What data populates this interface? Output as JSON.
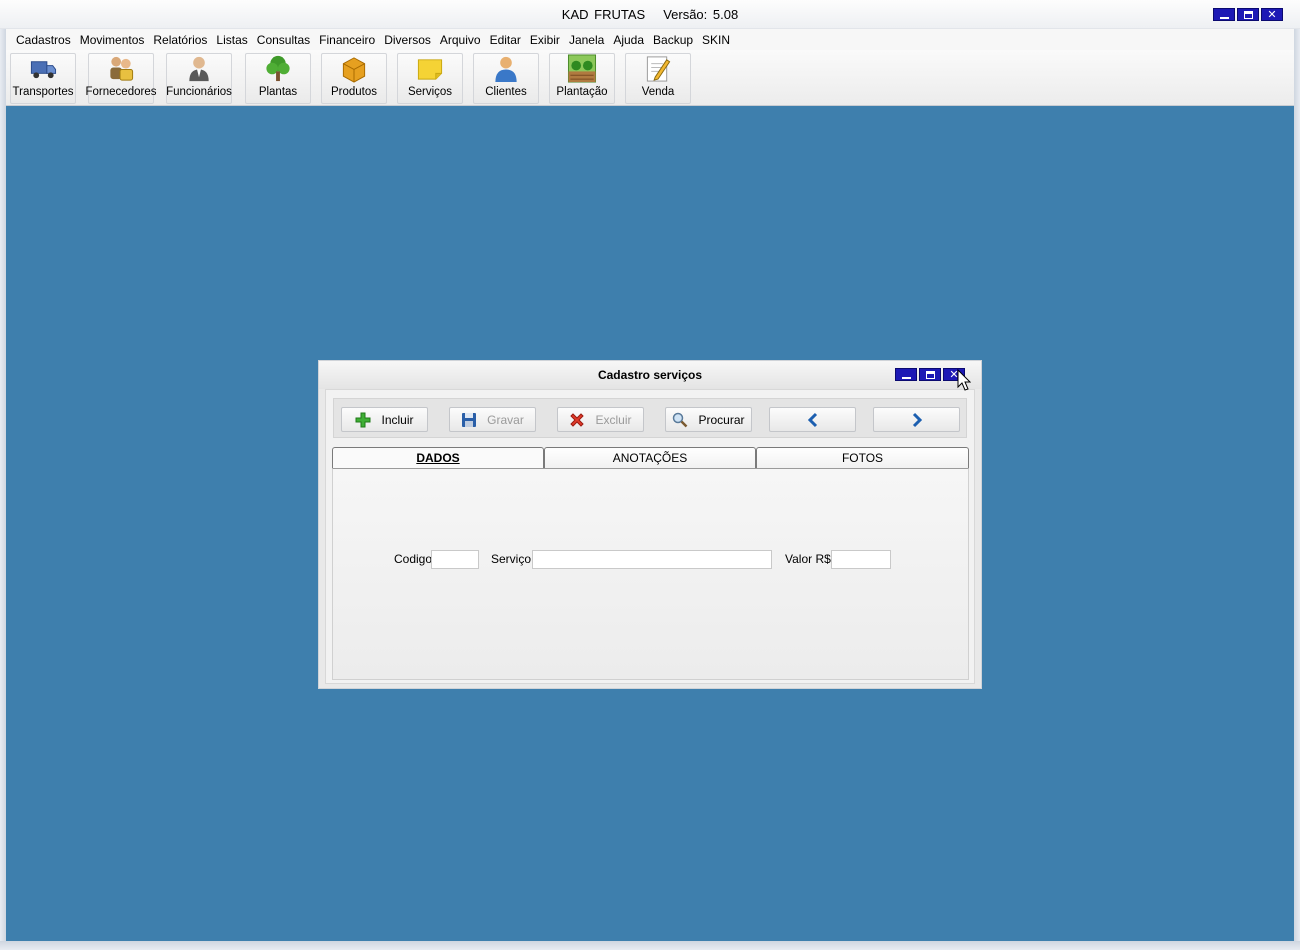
{
  "app": {
    "title": "KAD FRUTAS",
    "version": "Versão: 5.08"
  },
  "menu": [
    "Cadastros",
    "Movimentos",
    "Relatórios",
    "Listas",
    "Consultas",
    "Financeiro",
    "Diversos",
    "Arquivo",
    "Editar",
    "Exibir",
    "Janela",
    "Ajuda",
    "Backup",
    "SKIN"
  ],
  "toolbar": {
    "transportes": "Transportes",
    "fornecedores": "Fornecedores",
    "funcionarios": "Funcionários",
    "plantas": "Plantas",
    "produtos": "Produtos",
    "servicos": "Serviços",
    "clientes": "Clientes",
    "plantacao": "Plantação",
    "venda": "Venda"
  },
  "dialog": {
    "title": "Cadastro serviços",
    "actions": {
      "incluir": "Incluir",
      "gravar": "Gravar",
      "excluir": "Excluir",
      "procurar": "Procurar"
    },
    "tabs": [
      "DADOS",
      "ANOTAÇÕES",
      "FOTOS"
    ],
    "active_tab": "DADOS",
    "fields": {
      "codigo_label": "Codigo",
      "codigo_value": "",
      "servico_label": "Serviço",
      "servico_value": "",
      "valor_label": "Valor R$",
      "valor_value": ""
    }
  },
  "colors": {
    "desktop_bg": "#3e7fad",
    "window_button": "#1d19b5"
  }
}
